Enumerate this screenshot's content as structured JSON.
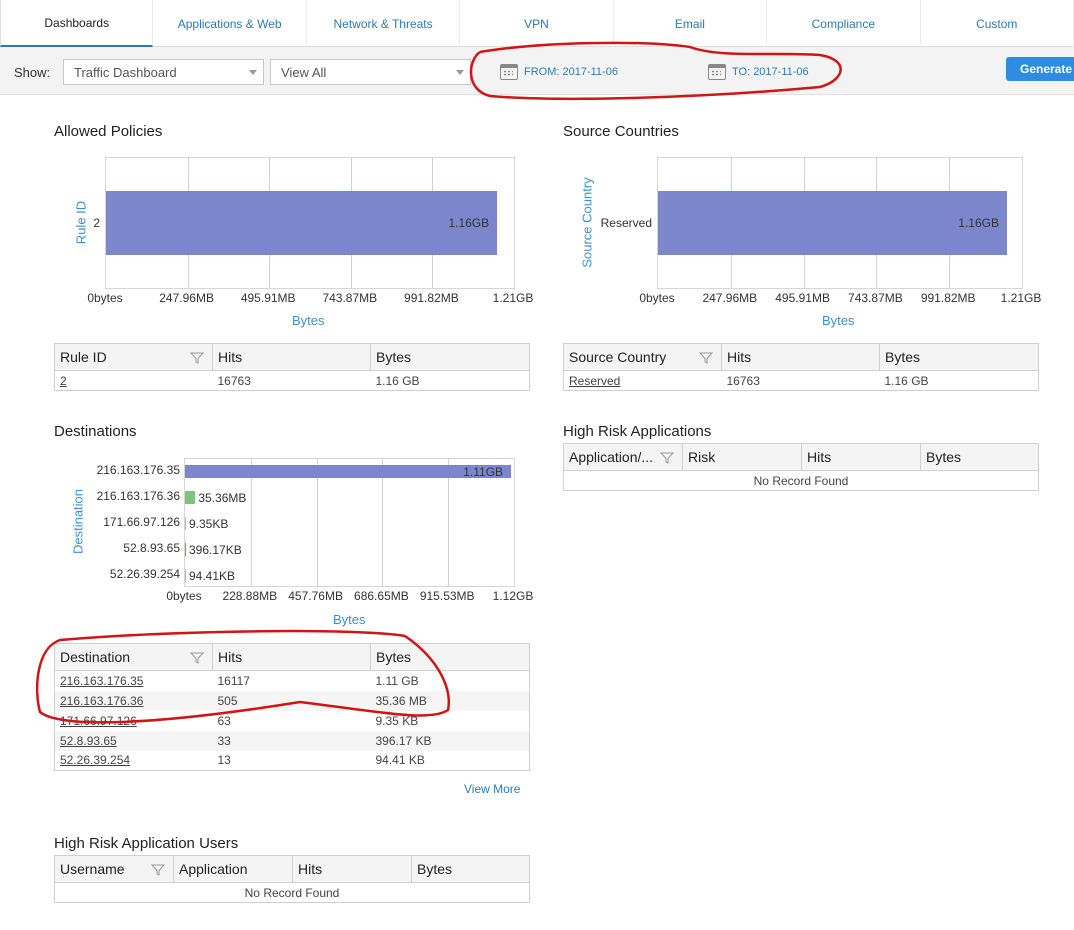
{
  "tabs": [
    "Dashboards",
    "Applications & Web",
    "Network & Threats",
    "VPN",
    "Email",
    "Compliance",
    "Custom"
  ],
  "toolbar": {
    "show_label": "Show:",
    "dashboard_select": "Traffic Dashboard",
    "view_select": "View All",
    "from_label": "FROM: 2017-11-06",
    "to_label": "TO: 2017-11-06",
    "generate_label": "Generate"
  },
  "allowed_policies": {
    "title": "Allowed Policies",
    "chart_data": {
      "type": "bar",
      "orientation": "horizontal",
      "categories": [
        "2"
      ],
      "values": [
        1.16
      ],
      "value_labels": [
        "1.16GB"
      ],
      "ylabel": "Rule ID",
      "xlabel": "Bytes",
      "xticks": [
        "0bytes",
        "247.96MB",
        "495.91MB",
        "743.87MB",
        "991.82MB",
        "1.21GB"
      ],
      "xlim_gb": [
        0,
        1.21
      ],
      "color": "#7b86cc"
    },
    "table": {
      "headers": [
        "Rule ID",
        "Hits",
        "Bytes"
      ],
      "rows": [
        [
          "2",
          "16763",
          "1.16 GB"
        ]
      ]
    }
  },
  "source_countries": {
    "title": "Source Countries",
    "chart_data": {
      "type": "bar",
      "orientation": "horizontal",
      "categories": [
        "Reserved"
      ],
      "values": [
        1.16
      ],
      "value_labels": [
        "1.16GB"
      ],
      "ylabel": "Source Country",
      "xlabel": "Bytes",
      "xticks": [
        "0bytes",
        "247.96MB",
        "495.91MB",
        "743.87MB",
        "991.82MB",
        "1.21GB"
      ],
      "xlim_gb": [
        0,
        1.21
      ],
      "color": "#7b86cc"
    },
    "table": {
      "headers": [
        "Source Country",
        "Hits",
        "Bytes"
      ],
      "rows": [
        [
          "Reserved",
          "16763",
          "1.16 GB"
        ]
      ]
    }
  },
  "destinations": {
    "title": "Destinations",
    "chart_data": {
      "type": "bar",
      "orientation": "horizontal",
      "categories": [
        "216.163.176.35",
        "216.163.176.36",
        "171.66.97.126",
        "52.8.93.65",
        "52.26.39.254"
      ],
      "values": [
        1.11,
        0.03536,
        9.35e-06,
        0.00039617,
        9.441e-05
      ],
      "value_labels": [
        "1.11GB",
        "35.36MB",
        "9.35KB",
        "396.17KB",
        "94.41KB"
      ],
      "colors": [
        "#7b86cc",
        "#7cc47c",
        "#e8b24c",
        "#e06c6c",
        "#8cc9e8"
      ],
      "ylabel": "Destination",
      "xlabel": "Bytes",
      "xticks": [
        "0bytes",
        "228.88MB",
        "457.76MB",
        "686.65MB",
        "915.53MB",
        "1.12GB"
      ],
      "xlim_gb": [
        0,
        1.12
      ]
    },
    "table": {
      "headers": [
        "Destination",
        "Hits",
        "Bytes"
      ],
      "rows": [
        [
          "216.163.176.35",
          "16117",
          "1.11 GB"
        ],
        [
          "216.163.176.36",
          "505",
          "35.36 MB"
        ],
        [
          "171.66.97.126",
          "63",
          "9.35 KB"
        ],
        [
          "52.8.93.65",
          "33",
          "396.17 KB"
        ],
        [
          "52.26.39.254",
          "13",
          "94.41 KB"
        ]
      ]
    },
    "view_more": "View More"
  },
  "high_risk_apps": {
    "title": "High Risk Applications",
    "headers": [
      "Application/...",
      "Risk",
      "Hits",
      "Bytes"
    ],
    "empty": "No Record Found"
  },
  "high_risk_users": {
    "title": "High Risk Application Users",
    "headers": [
      "Username",
      "Application",
      "Hits",
      "Bytes"
    ],
    "empty": "No Record Found"
  }
}
